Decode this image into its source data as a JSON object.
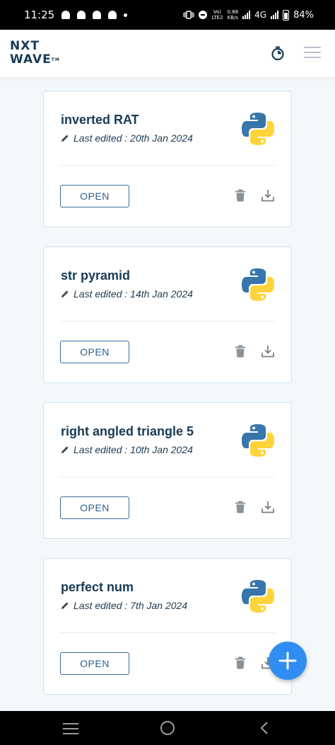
{
  "status_bar": {
    "time": "11:25",
    "network_top": "Vo)",
    "network_bottom": "LTE2",
    "speed_top": "0.88",
    "speed_bottom": "KB/s",
    "network_type": "4G",
    "battery": "84%"
  },
  "header": {
    "logo_line1": "NXT",
    "logo_line2": "WAVE",
    "logo_tm": "TM",
    "icons": [
      "timer-icon",
      "menu-icon"
    ]
  },
  "cards": [
    {
      "title": "inverted RAT",
      "edited": "Last edited : 20th Jan 2024",
      "open_label": "OPEN"
    },
    {
      "title": "str pyramid",
      "edited": "Last edited : 14th Jan 2024",
      "open_label": "OPEN"
    },
    {
      "title": "right angled triangle 5",
      "edited": "Last edited : 10th Jan 2024",
      "open_label": "OPEN"
    },
    {
      "title": "perfect num",
      "edited": "Last edited : 7th Jan 2024",
      "open_label": "OPEN"
    }
  ],
  "colors": {
    "title": "#183b56",
    "accent": "#0b69ff",
    "fab": "#2f8df3",
    "card_border": "#cfe1ef",
    "python_blue": "#3776ab",
    "python_yellow": "#ffd43b"
  }
}
